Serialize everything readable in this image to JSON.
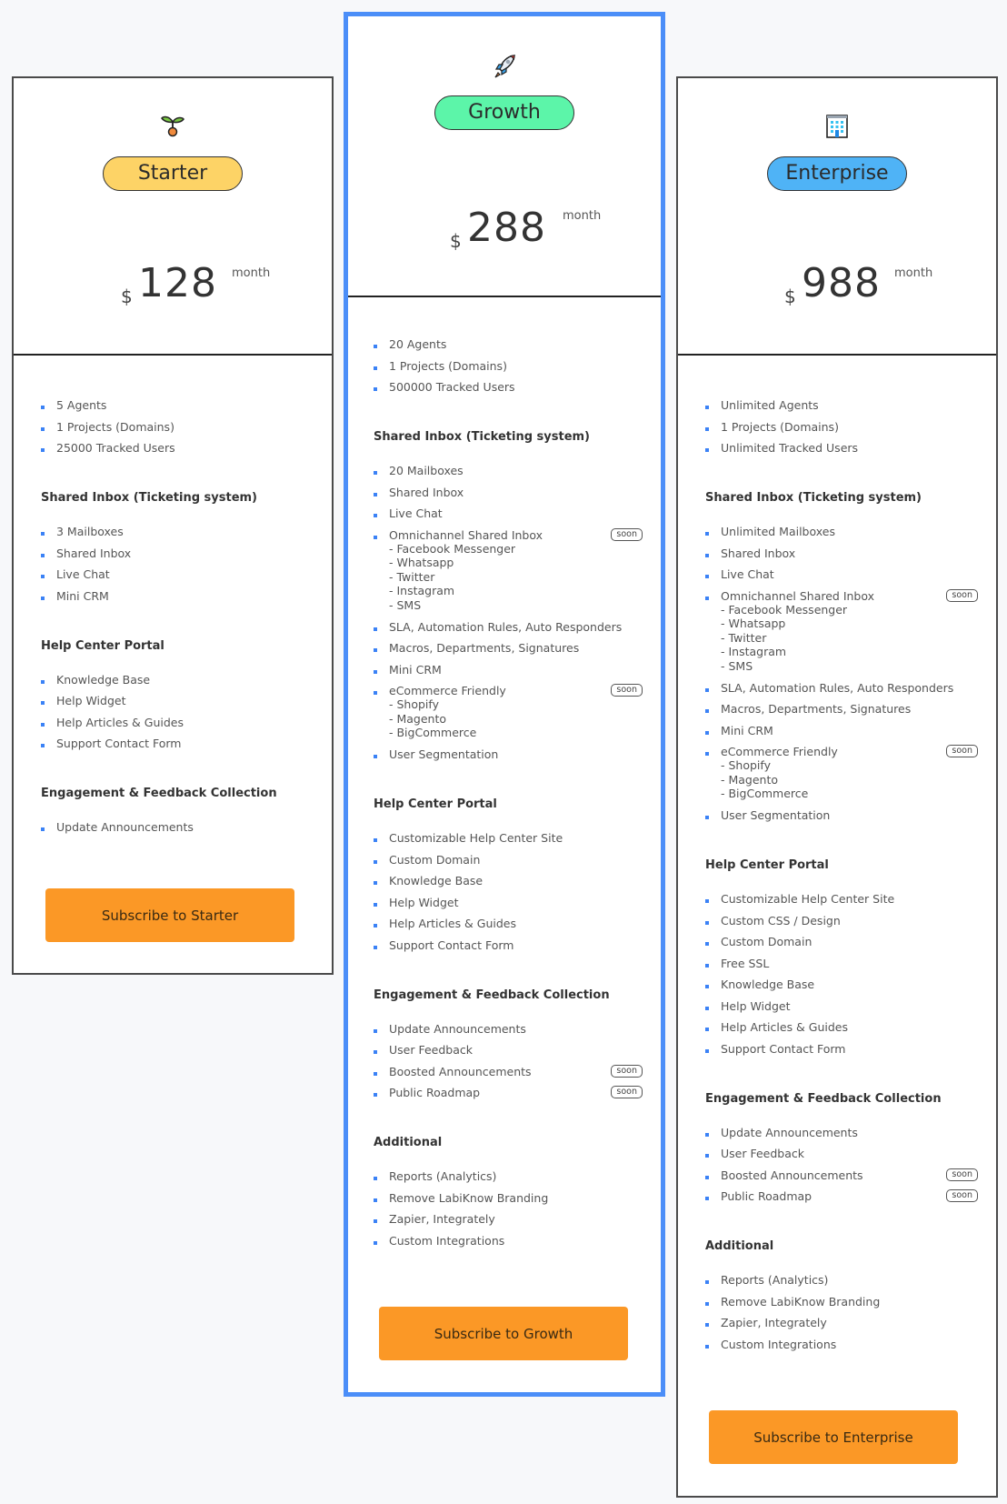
{
  "plans": [
    {
      "name": "Starter",
      "icon": "seedling-icon",
      "pill_color": "#fdd366",
      "currency": "$",
      "price": "128",
      "period": "month",
      "highlighted": false,
      "basics": [
        {
          "text": "5 Agents"
        },
        {
          "text": "1 Projects (Domains)"
        },
        {
          "text": "25000 Tracked Users"
        }
      ],
      "sections": [
        {
          "title": "Shared Inbox (Ticketing system)",
          "items": [
            {
              "text": "3 Mailboxes"
            },
            {
              "text": "Shared Inbox"
            },
            {
              "text": "Live Chat"
            },
            {
              "text": "Mini CRM"
            }
          ]
        },
        {
          "title": "Help Center Portal",
          "items": [
            {
              "text": "Knowledge Base"
            },
            {
              "text": "Help Widget"
            },
            {
              "text": "Help Articles & Guides"
            },
            {
              "text": "Support Contact Form"
            }
          ]
        },
        {
          "title": "Engagement & Feedback Collection",
          "items": [
            {
              "text": "Update Announcements"
            }
          ]
        }
      ],
      "cta": "Subscribe to Starter"
    },
    {
      "name": "Growth",
      "icon": "rocket-icon",
      "pill_color": "#5cf5a9",
      "currency": "$",
      "price": "288",
      "period": "month",
      "highlighted": true,
      "basics": [
        {
          "text": "20 Agents"
        },
        {
          "text": "1 Projects (Domains)"
        },
        {
          "text": "500000 Tracked Users"
        }
      ],
      "sections": [
        {
          "title": "Shared Inbox (Ticketing system)",
          "items": [
            {
              "text": "20 Mailboxes"
            },
            {
              "text": "Shared Inbox"
            },
            {
              "text": "Live Chat"
            },
            {
              "text": "Omnichannel Shared Inbox",
              "sub": [
                "- Facebook Messenger",
                "- Whatsapp",
                "- Twitter",
                "- Instagram",
                "- SMS"
              ],
              "badge": "soon"
            },
            {
              "text": "SLA, Automation Rules, Auto Responders"
            },
            {
              "text": "Macros, Departments, Signatures"
            },
            {
              "text": "Mini CRM"
            },
            {
              "text": "eCommerce Friendly",
              "sub": [
                "- Shopify",
                "- Magento",
                "- BigCommerce"
              ],
              "badge": "soon"
            },
            {
              "text": "User Segmentation"
            }
          ]
        },
        {
          "title": "Help Center Portal",
          "items": [
            {
              "text": "Customizable Help Center Site"
            },
            {
              "text": "Custom Domain"
            },
            {
              "text": "Knowledge Base"
            },
            {
              "text": "Help Widget"
            },
            {
              "text": "Help Articles & Guides"
            },
            {
              "text": "Support Contact Form"
            }
          ]
        },
        {
          "title": "Engagement & Feedback Collection",
          "items": [
            {
              "text": "Update Announcements"
            },
            {
              "text": "User Feedback"
            },
            {
              "text": "Boosted Announcements",
              "badge": "soon"
            },
            {
              "text": "Public Roadmap",
              "badge": "soon"
            }
          ]
        },
        {
          "title": "Additional",
          "items": [
            {
              "text": "Reports (Analytics)"
            },
            {
              "text": "Remove LabiKnow Branding"
            },
            {
              "text": "Zapier, Integrately"
            },
            {
              "text": "Custom Integrations"
            }
          ]
        }
      ],
      "cta": "Subscribe to Growth"
    },
    {
      "name": "Enterprise",
      "icon": "office-building-icon",
      "pill_color": "#4fb3f6",
      "currency": "$",
      "price": "988",
      "period": "month",
      "highlighted": false,
      "basics": [
        {
          "text": "Unlimited Agents"
        },
        {
          "text": "1 Projects (Domains)"
        },
        {
          "text": "Unlimited Tracked Users"
        }
      ],
      "sections": [
        {
          "title": "Shared Inbox (Ticketing system)",
          "items": [
            {
              "text": "Unlimited Mailboxes"
            },
            {
              "text": "Shared Inbox"
            },
            {
              "text": "Live Chat"
            },
            {
              "text": "Omnichannel Shared Inbox",
              "sub": [
                "- Facebook Messenger",
                "- Whatsapp",
                "- Twitter",
                "- Instagram",
                "- SMS"
              ],
              "badge": "soon"
            },
            {
              "text": "SLA, Automation Rules, Auto Responders"
            },
            {
              "text": "Macros, Departments, Signatures"
            },
            {
              "text": "Mini CRM"
            },
            {
              "text": "eCommerce Friendly",
              "sub": [
                "- Shopify",
                "- Magento",
                "- BigCommerce"
              ],
              "badge": "soon"
            },
            {
              "text": "User Segmentation"
            }
          ]
        },
        {
          "title": "Help Center Portal",
          "items": [
            {
              "text": "Customizable Help Center Site"
            },
            {
              "text": "Custom CSS / Design"
            },
            {
              "text": "Custom Domain"
            },
            {
              "text": "Free SSL"
            },
            {
              "text": "Knowledge Base"
            },
            {
              "text": "Help Widget"
            },
            {
              "text": "Help Articles & Guides"
            },
            {
              "text": "Support Contact Form"
            }
          ]
        },
        {
          "title": "Engagement & Feedback Collection",
          "items": [
            {
              "text": "Update Announcements"
            },
            {
              "text": "User Feedback"
            },
            {
              "text": "Boosted Announcements",
              "badge": "soon"
            },
            {
              "text": "Public Roadmap",
              "badge": "soon"
            }
          ]
        },
        {
          "title": "Additional",
          "items": [
            {
              "text": "Reports (Analytics)"
            },
            {
              "text": "Remove LabiKnow Branding"
            },
            {
              "text": "Zapier, Integrately"
            },
            {
              "text": "Custom Integrations"
            }
          ]
        }
      ],
      "cta": "Subscribe to Enterprise"
    }
  ],
  "colors": {
    "featured_border": "#4b8ef8",
    "bullet": "#3b82f6",
    "cta": "#fb9826"
  }
}
